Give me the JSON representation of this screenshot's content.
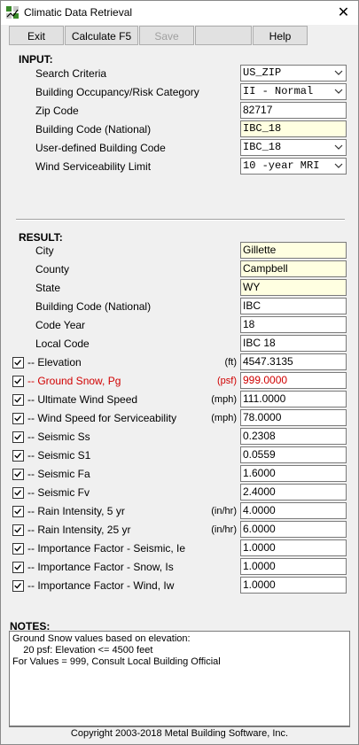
{
  "window": {
    "title": "Climatic Data Retrieval",
    "close_label": "✕"
  },
  "toolbar": {
    "exit_label": "Exit",
    "calculate_label": "Calculate F5",
    "save_label": "Save",
    "blank_label": "",
    "help_label": "Help"
  },
  "input": {
    "heading": "INPUT:",
    "rows": [
      {
        "label": "Search Criteria",
        "value": "US_ZIP"
      },
      {
        "label": "Building Occupancy/Risk Category",
        "value": "II - Normal"
      },
      {
        "label": "Zip Code",
        "value": "82717"
      },
      {
        "label": "Building Code (National)",
        "value": "IBC_18"
      },
      {
        "label": "User-defined Building Code",
        "value": "IBC_18"
      },
      {
        "label": "Wind Serviceability Limit",
        "value": "10 -year MRI"
      }
    ]
  },
  "result": {
    "heading": "RESULT:",
    "info_rows": [
      {
        "label": "City",
        "value": "Gillette"
      },
      {
        "label": "County",
        "value": "Campbell"
      },
      {
        "label": "State",
        "value": "WY"
      },
      {
        "label": "Building Code (National)",
        "value": "IBC"
      },
      {
        "label": "Code Year",
        "value": "18"
      },
      {
        "label": "Local Code",
        "value": "IBC 18"
      }
    ],
    "checked_rows": [
      {
        "label": "-- Elevation",
        "unit": "(ft)",
        "value": "4547.3135",
        "checked": true
      },
      {
        "label": "-- Ground Snow, Pg",
        "unit": "(psf)",
        "value": "999.0000",
        "checked": true
      },
      {
        "label": "-- Ultimate Wind Speed",
        "unit": "(mph)",
        "value": "111.0000",
        "checked": true
      },
      {
        "label": "-- Wind Speed for Serviceability",
        "unit": "(mph)",
        "value": "78.0000",
        "checked": true
      },
      {
        "label": "-- Seismic Ss",
        "unit": "",
        "value": "0.2308",
        "checked": true
      },
      {
        "label": "-- Seismic S1",
        "unit": "",
        "value": "0.0559",
        "checked": true
      },
      {
        "label": "-- Seismic Fa",
        "unit": "",
        "value": "1.6000",
        "checked": true
      },
      {
        "label": "-- Seismic Fv",
        "unit": "",
        "value": "2.4000",
        "checked": true
      },
      {
        "label": "-- Rain Intensity, 5 yr",
        "unit": "(in/hr)",
        "value": "4.0000",
        "checked": true
      },
      {
        "label": "-- Rain Intensity, 25 yr",
        "unit": "(in/hr)",
        "value": "6.0000",
        "checked": true
      },
      {
        "label": "-- Importance Factor - Seismic, Ie",
        "unit": "",
        "value": "1.0000",
        "checked": true
      },
      {
        "label": "-- Importance Factor - Snow, Is",
        "unit": "",
        "value": "1.0000",
        "checked": true
      },
      {
        "label": "-- Importance Factor - Wind, Iw",
        "unit": "",
        "value": "1.0000",
        "checked": true
      }
    ]
  },
  "notes": {
    "heading": "NOTES:",
    "lines": [
      "Ground Snow values based on elevation:",
      "    20 psf: Elevation <= 4500 feet",
      "For Values = 999, Consult Local Building Official"
    ]
  },
  "footer": {
    "copyright": "Copyright 2003-2018  Metal Building Software, Inc."
  },
  "colors": {
    "highlight_text": "#d00000",
    "readonly_field": "#ffffe1"
  }
}
